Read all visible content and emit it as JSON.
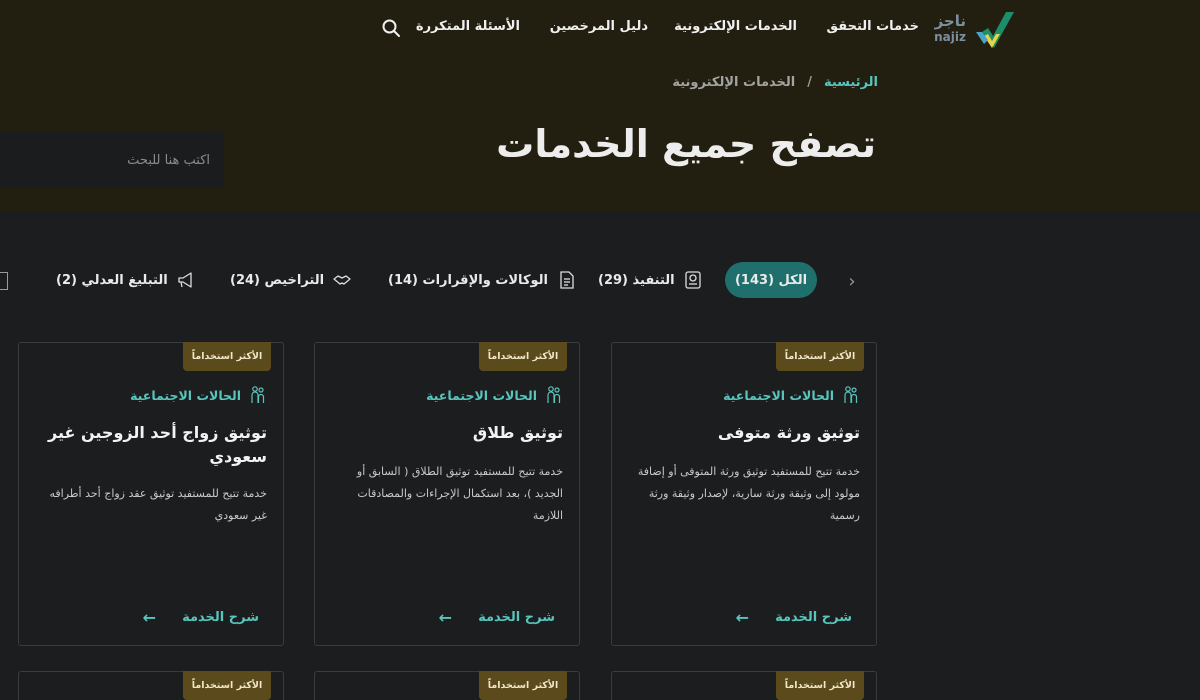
{
  "nav": {
    "logo_ar": "ناجز",
    "logo_en": "najiz",
    "items": [
      "خدمات التحقق",
      "الخدمات الإلكترونية",
      "دليل المرخصين",
      "الأسئلة المتكررة"
    ]
  },
  "breadcrumb": {
    "home": "الرئيسية",
    "separator": "/",
    "current": "الخدمات الإلكترونية"
  },
  "page": {
    "title": "تصفح جميع الخدمات"
  },
  "search": {
    "placeholder": "اكتب هنا للبحث"
  },
  "tabs": [
    {
      "label": "الكل (143)",
      "active": true
    },
    {
      "label": "التنفيذ (29)",
      "icon": "document-badge-icon"
    },
    {
      "label": "الوكالات والإقرارات (14)",
      "icon": "document-list-icon"
    },
    {
      "label": "التراخيص (24)",
      "icon": "handshake-icon"
    },
    {
      "label": "التبليغ العدلي (2)",
      "icon": "megaphone-icon"
    }
  ],
  "cards": [
    {
      "badge": "الأكثر استخداماً",
      "category": "الحالات الاجتماعية",
      "title": "توثيق ورثة متوفى",
      "description": "خدمة تتيح للمستفيد توثيق ورثة المتوفى أو إضافة مولود إلى وثيقة ورثة سارية، لإصدار وثيقة ورثة رسمية",
      "more": "شرح الخدمة"
    },
    {
      "badge": "الأكثر استخداماً",
      "category": "الحالات الاجتماعية",
      "title": "توثيق طلاق",
      "description": "خدمة تتيح للمستفيد توثيق الطلاق ( السابق أو الجديد )، بعد استكمال الإجراءات والمصادقات اللازمة",
      "more": "شرح الخدمة"
    },
    {
      "badge": "الأكثر استخداماً",
      "category": "الحالات الاجتماعية",
      "title": "توثيق زواج أحد الزوجين غير سعودي",
      "description": "خدمة تتيح للمستفيد توثيق عقد زواج أحد أطرافه غير سعودي",
      "more": "شرح الخدمة"
    }
  ],
  "stub_badge": "الأكثر استخداماً",
  "colors": {
    "accent": "#58c6bd",
    "active_tab": "#1f6f6c",
    "badge": "#5a4a1c",
    "hero": "#221e10"
  }
}
